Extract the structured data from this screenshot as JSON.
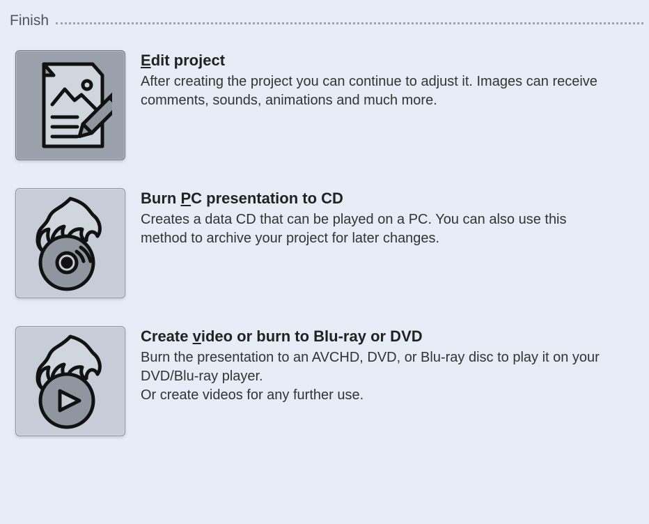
{
  "section": {
    "title": "Finish"
  },
  "options": [
    {
      "id": "edit-project",
      "title_pre": "",
      "title_ul": "E",
      "title_post": "dit project",
      "desc": "After creating the project you can continue to adjust it. Images can receive comments, sounds, animations and much more.",
      "selected": true,
      "icon": "document-edit"
    },
    {
      "id": "burn-pc-cd",
      "title_pre": "Burn ",
      "title_ul": "P",
      "title_post": "C presentation to CD",
      "desc": "Creates a data CD that can be played on a PC. You can also use this method to archive your project for later changes.",
      "selected": false,
      "icon": "burn-disc"
    },
    {
      "id": "create-video-dvd",
      "title_pre": "Create ",
      "title_ul": "v",
      "title_post": "ideo or burn to Blu-ray or DVD",
      "desc": "Burn the presentation to an AVCHD, DVD, or Blu-ray disc to play it on your DVD/Blu-ray player.\nOr create videos for any further use.",
      "selected": false,
      "icon": "burn-play"
    }
  ]
}
